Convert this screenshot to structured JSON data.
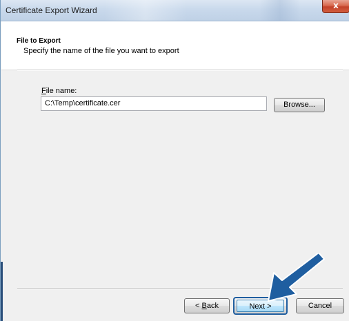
{
  "window": {
    "title": "Certificate Export Wizard",
    "close_label": "x"
  },
  "header": {
    "title": "File to Export",
    "subtitle": "Specify the name of the file you want to export"
  },
  "file_name": {
    "label_accel": "F",
    "label_rest": "ile name:",
    "value": "C:\\Temp\\certificate.cer"
  },
  "buttons": {
    "browse": "Browse...",
    "back_prefix": "< ",
    "back_accel": "B",
    "back_rest": "ack",
    "next": "Next >",
    "cancel": "Cancel"
  },
  "annotation": {
    "arrow_color": "#1f5ea0",
    "arrow_icon": "pointer-arrow-icon"
  }
}
